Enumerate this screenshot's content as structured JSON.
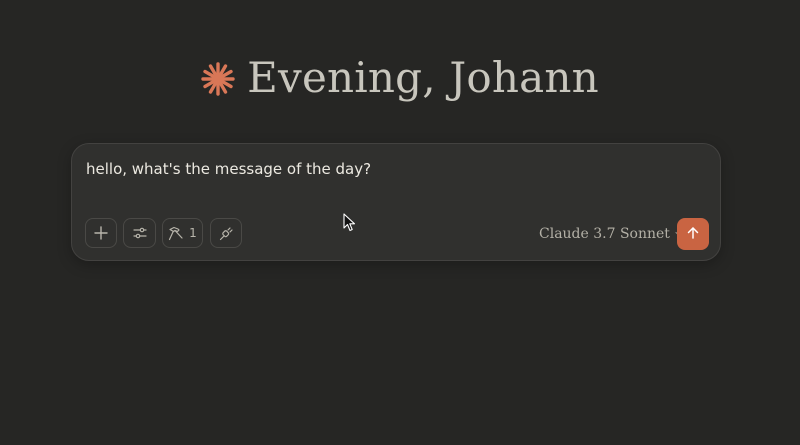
{
  "greeting": {
    "text": "Evening, Johann",
    "logo_icon": "claude-starburst-icon",
    "logo_color": "#d97757"
  },
  "composer": {
    "prompt_text": "hello, what's the message of the day?",
    "add_icon": "plus-icon",
    "settings_icon": "sliders-icon",
    "tools_icon": "hammer-icon",
    "tools_count": "1",
    "connect_icon": "plug-icon",
    "model_name": "Claude 3.7 Sonnet",
    "model_chevron_icon": "chevron-down-icon",
    "send_icon": "arrow-up-icon",
    "send_color": "#c96442"
  },
  "colors": {
    "background": "#262624",
    "composer_bg": "#30302e",
    "text": "#ece9e1"
  }
}
